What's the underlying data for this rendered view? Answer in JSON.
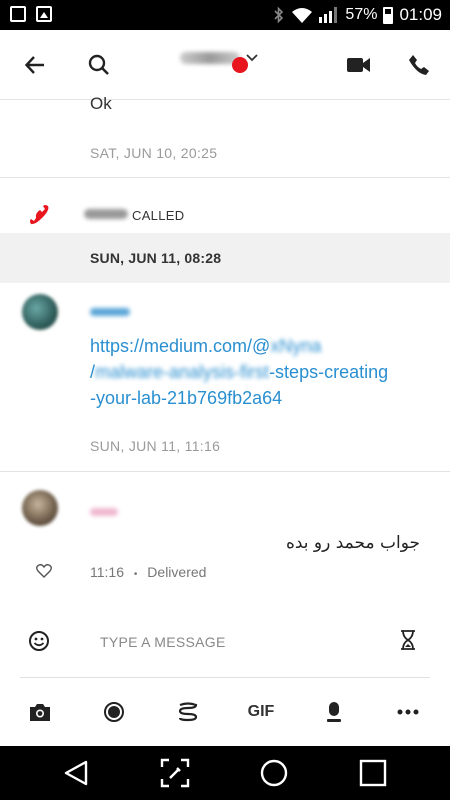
{
  "status_bar": {
    "battery": "57%",
    "time": "01:09"
  },
  "header": {
    "title_suffix": "⌄"
  },
  "messages": {
    "first_text": "Ok",
    "first_timestamp": "SAT, JUN 10, 20:25",
    "call_text": "CALLED",
    "date_separator": "SUN, JUN 11, 08:28",
    "link_line1": "https://medium.com/@",
    "link_line1_blurred": "xNyna",
    "link_line2_prefix": "/",
    "link_line2_blurred": "malware-analysis-first",
    "link_line2_suffix": "-steps-creating",
    "link_line3": "-your-lab-21b769fb2a64",
    "link_timestamp": "SUN, JUN 11, 11:16",
    "rtl_text": "جواب محمد رو بده",
    "rtl_time": "11:16",
    "rtl_separator": "•",
    "rtl_status": "Delivered"
  },
  "composer": {
    "placeholder": "TYPE A MESSAGE"
  },
  "toolbar": {
    "gif_label": "GIF"
  },
  "colors": {
    "accent_link": "#2a8fd0",
    "missed_call": "#e8141e"
  }
}
